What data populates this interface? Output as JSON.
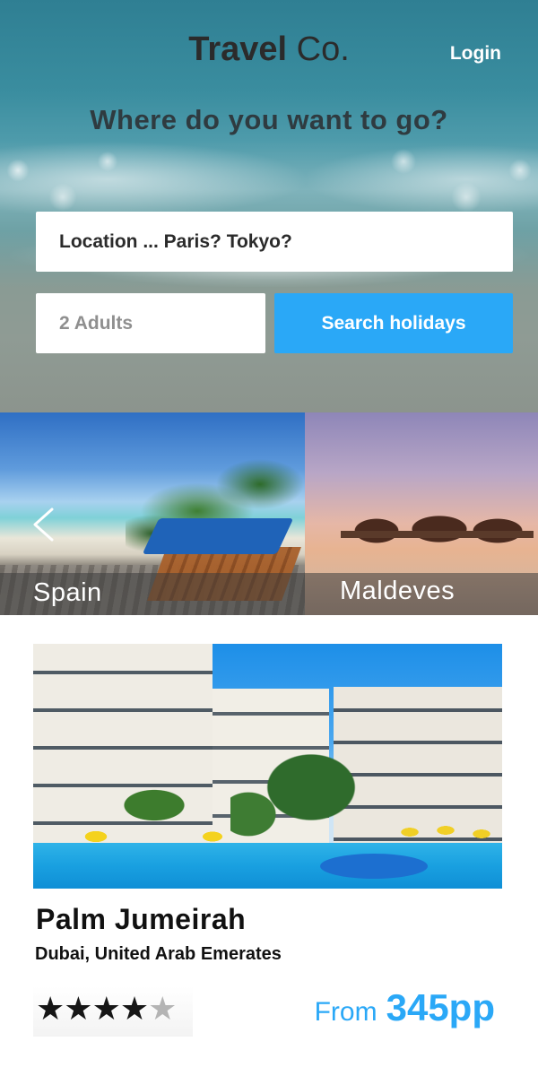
{
  "header": {
    "brand_bold": "Travel",
    "brand_light": "Co.",
    "login_label": "Login"
  },
  "search": {
    "headline": "Where do you want to go?",
    "location_placeholder": "Location ... Paris? Tokyo?",
    "guests_placeholder": "2 Adults",
    "search_button_label": "Search holidays"
  },
  "destinations": [
    {
      "label": "Spain"
    },
    {
      "label": "Maldeves"
    }
  ],
  "featured_hotel": {
    "name": "Palm Jumeirah",
    "location": "Dubai, United Arab Emerates",
    "rating": 4,
    "rating_max": 5,
    "price_prefix": "From",
    "price": "345pp"
  },
  "colors": {
    "accent": "#2aa8f7",
    "text_dark": "#111111",
    "brand": "#2b2b2b"
  },
  "icons": {
    "carousel_prev": "chevron-left-icon",
    "star": "star-icon"
  }
}
